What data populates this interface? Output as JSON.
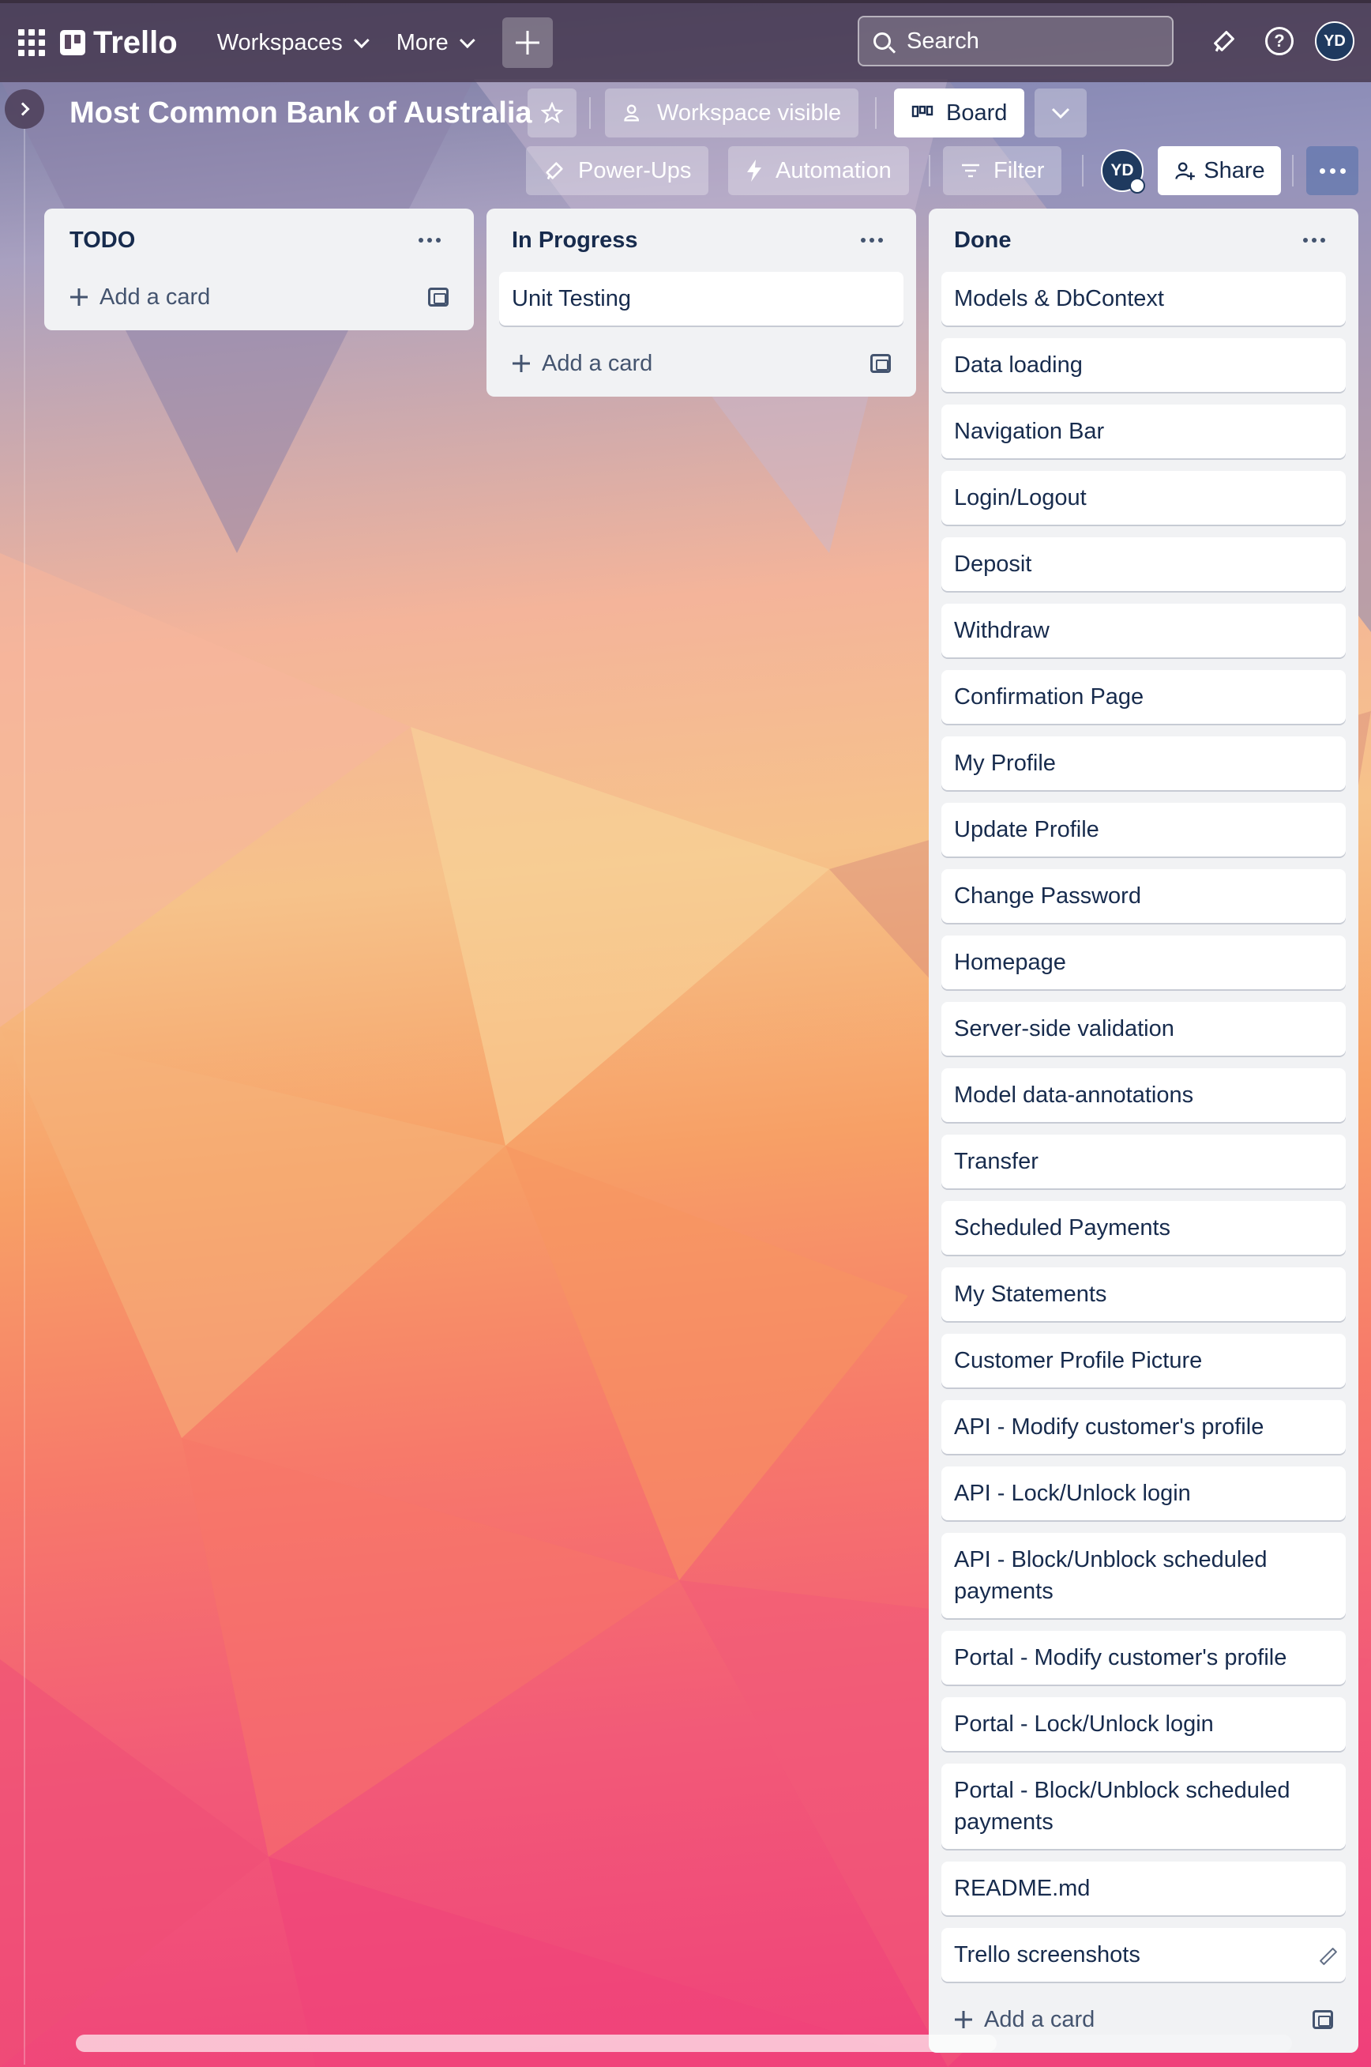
{
  "topnav": {
    "brand": "Trello",
    "workspaces_label": "Workspaces",
    "more_label": "More",
    "search_placeholder": "Search",
    "avatar_initials": "YD"
  },
  "board": {
    "title": "Most Common Bank of Australia",
    "visibility_label": "Workspace visible",
    "view_label": "Board",
    "powerups_label": "Power-Ups",
    "automation_label": "Automation",
    "filter_label": "Filter",
    "member_initials": "YD",
    "share_label": "Share"
  },
  "lists": [
    {
      "title": "TODO",
      "cards": [],
      "add_label": "Add a card"
    },
    {
      "title": "In Progress",
      "cards": [
        "Unit Testing"
      ],
      "add_label": "Add a card"
    },
    {
      "title": "Done",
      "cards": [
        "Models & DbContext",
        "Data loading",
        "Navigation Bar",
        "Login/Logout",
        "Deposit",
        "Withdraw",
        "Confirmation Page",
        "My Profile",
        "Update Profile",
        "Change Password",
        "Homepage",
        "Server-side validation",
        "Model data-annotations",
        "Transfer",
        "Scheduled Payments",
        "My Statements",
        "Customer Profile Picture",
        "API - Modify customer's profile",
        "API - Lock/Unlock login",
        "API - Block/Unblock scheduled payments",
        "Portal - Modify customer's profile",
        "Portal - Lock/Unlock login",
        "Portal - Block/Unblock scheduled payments",
        "README.md",
        "Trello screenshots"
      ],
      "add_label": "Add a card"
    }
  ]
}
